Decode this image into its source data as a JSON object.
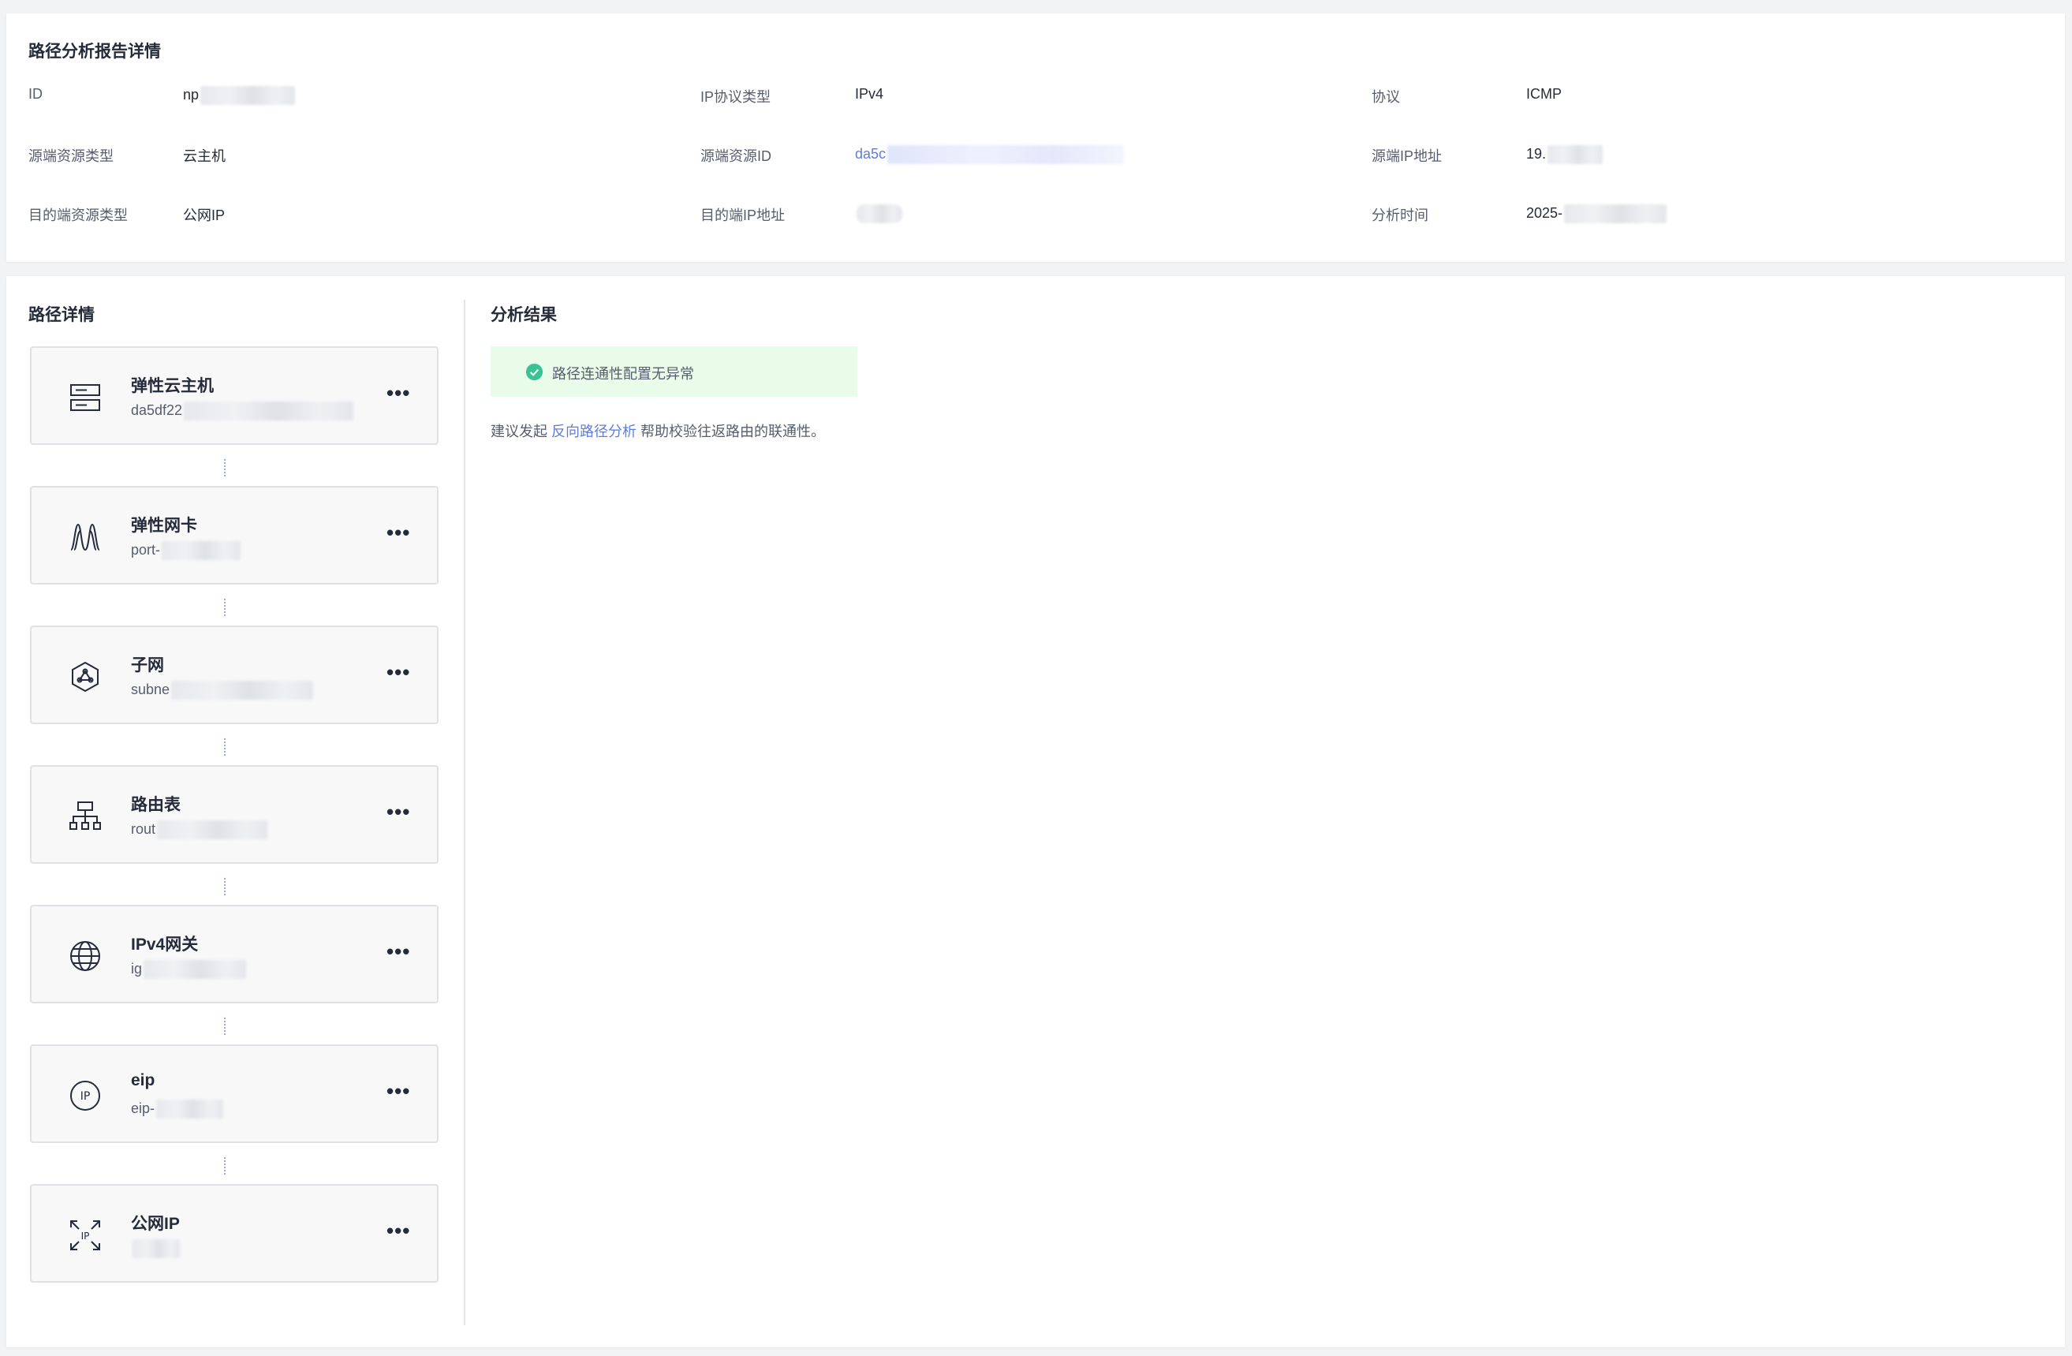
{
  "summary": {
    "title": "路径分析报告详情",
    "fields": [
      {
        "label": "ID",
        "value": "np"
      },
      {
        "label": "IP协议类型",
        "value": "IPv4"
      },
      {
        "label": "协议",
        "value": "ICMP"
      },
      {
        "label": "源端资源类型",
        "value": "云主机"
      },
      {
        "label": "源端资源ID",
        "value": "da5c"
      },
      {
        "label": "源端IP地址",
        "value": "19."
      },
      {
        "label": "目的端资源类型",
        "value": "公网IP"
      },
      {
        "label": "目的端IP地址",
        "value": ""
      },
      {
        "label": "分析时间",
        "value": "2025-"
      }
    ]
  },
  "path": {
    "title": "路径详情",
    "nodes": [
      {
        "name": "弹性云主机",
        "id": "da5df22",
        "icon": "server-icon"
      },
      {
        "name": "弹性网卡",
        "id": "port-",
        "icon": "nic-icon"
      },
      {
        "name": "子网",
        "id": "subne",
        "icon": "subnet-icon"
      },
      {
        "name": "路由表",
        "id": "rout",
        "icon": "route-table-icon"
      },
      {
        "name": "IPv4网关",
        "id": "ig",
        "icon": "globe-icon"
      },
      {
        "name": "eip",
        "id": "eip-",
        "icon": "eip-icon"
      },
      {
        "name": "公网IP",
        "id": "",
        "icon": "public-ip-icon"
      }
    ],
    "more_label": "•••"
  },
  "result": {
    "title": "分析结果",
    "status_message": "路径连通性配置无异常",
    "suggest_prefix": "建议发起 ",
    "suggest_link": "反向路径分析",
    "suggest_suffix": " 帮助校验往返路由的联通性。",
    "colors": {
      "success": "#3ac295",
      "success_bg": "#e9fbe9",
      "link": "#5e7ce0"
    }
  }
}
